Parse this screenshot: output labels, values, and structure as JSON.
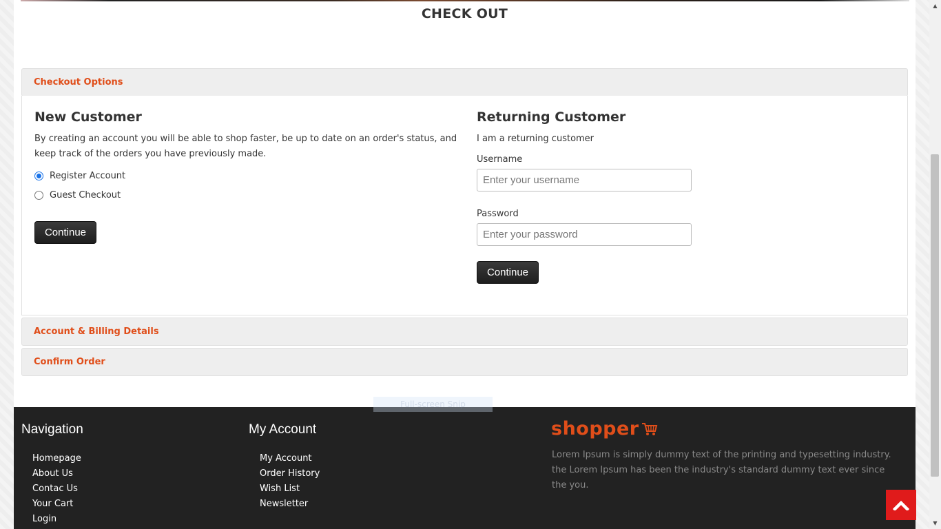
{
  "page": {
    "title": "CHECK OUT"
  },
  "checkout_options": {
    "header": "Checkout Options",
    "new_customer": {
      "heading": "New Customer",
      "description": "By creating an account you will be able to shop faster, be up to date on an order's status, and keep track of the orders you have previously made.",
      "options": [
        {
          "label": "Register Account",
          "checked": true
        },
        {
          "label": "Guest Checkout",
          "checked": false
        }
      ],
      "continue_label": "Continue"
    },
    "returning_customer": {
      "heading": "Returning Customer",
      "subtitle": "I am a returning customer",
      "username_label": "Username",
      "username_placeholder": "Enter your username",
      "password_label": "Password",
      "password_placeholder": "Enter your password",
      "continue_label": "Continue"
    }
  },
  "sections": {
    "billing": "Account & Billing Details",
    "confirm": "Confirm Order"
  },
  "overlay": {
    "snip_text": "Full-screen Snip"
  },
  "footer": {
    "navigation": {
      "heading": "Navigation",
      "items": [
        "Homepage",
        "About Us",
        "Contac Us",
        "Your Cart",
        "Login"
      ]
    },
    "my_account": {
      "heading": "My Account",
      "items": [
        "My Account",
        "Order History",
        "Wish List",
        "Newsletter"
      ]
    },
    "brand": {
      "logo_text": "shopper",
      "description": "Lorem Ipsum is simply dummy text of the printing and typesetting industry. the Lorem Ipsum has been the industry's standard dummy text ever since the you."
    }
  },
  "colors": {
    "accent": "#e04e1a",
    "footer_bg": "#222222",
    "button_bg": "#2a2a2a",
    "back_to_top": "#e01b1b"
  },
  "icons": {
    "logo_icon": "cart-icon",
    "back_to_top": "chevron-up-icon"
  }
}
